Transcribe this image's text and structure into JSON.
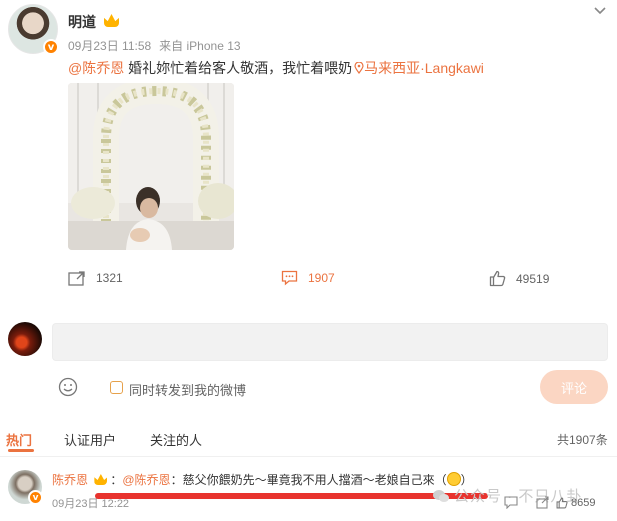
{
  "post": {
    "author": "明道",
    "date": "09月23日 11:58",
    "source": "来自 iPhone 13",
    "mention": "@陈乔恩",
    "text": " 婚礼妳忙着给客人敬酒，我忙着喂奶",
    "location": "马来西亚·Langkawi",
    "verified_badge": "v"
  },
  "actions": {
    "repost_count": "1321",
    "comment_count": "1907",
    "like_count": "49519"
  },
  "composer": {
    "forward_label": "同时转发到我的微博",
    "submit_label": "评论"
  },
  "tabs": [
    {
      "label": "热门"
    },
    {
      "label": "认证用户"
    },
    {
      "label": "关注的人"
    }
  ],
  "total_count": "共1907条",
  "comment": {
    "author": "陈乔恩",
    "separator": "：",
    "mention": "@陈乔恩",
    "text": "：慈父你餵奶先～畢竟我不用人擋酒～老娘自己來（",
    "text_end": "）",
    "date": "09月23日 12:22",
    "like_count": "8659"
  },
  "watermark": "公众号 · 不只八卦",
  "colors": {
    "accent": "#eb7340",
    "badge": "#ff8200",
    "submit_bg": "#fbd6c3",
    "redline": "#e8332e"
  }
}
